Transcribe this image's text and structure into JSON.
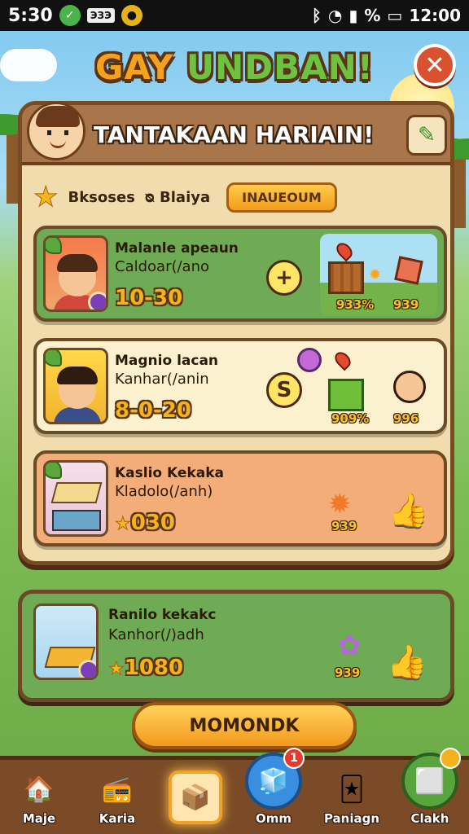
{
  "status": {
    "time_left": "5:30",
    "box_label": "ЭЗЭ",
    "right_time": "12:00",
    "percent": "%"
  },
  "title": {
    "part1": "GAY",
    "part2": "UNDBAN!"
  },
  "panel": {
    "title": "TANTAKAAN HARIAIN!"
  },
  "tabs": {
    "label1": "Bksoses",
    "label2": "ᴓ Blaiya",
    "active": "INAUEOUM"
  },
  "cards": [
    {
      "name": "Malanle apeaun",
      "sub": "Caldoar(/ano",
      "value": "10-30",
      "action": "+",
      "scene_lbl1": "933%",
      "scene_lbl2": "939"
    },
    {
      "name": "Magnio lacan",
      "sub": "Kanhar(/anin",
      "value": "8-0-20",
      "action": "S",
      "scene_lbl1": "909%",
      "scene_lbl2": "996"
    },
    {
      "name": "Kaslio Kekaka",
      "sub": "Kladolo(/anh)",
      "value": "030",
      "scene_lbl1": "939"
    }
  ],
  "bottom_card": {
    "name": "Ranilo kekakc",
    "sub": "Kanhor(/)adh",
    "value": "1080",
    "scene_lbl1": "939"
  },
  "main_button": {
    "label": "MOMONDK"
  },
  "nav": [
    {
      "label": "Maje",
      "icon": "house-icon"
    },
    {
      "label": "Karia",
      "icon": "radio-icon"
    },
    {
      "label": "",
      "icon": "crate-icon"
    },
    {
      "label": "Omm",
      "icon": "box-icon",
      "badge": "1"
    },
    {
      "label": "Paniagn",
      "icon": "card-icon"
    },
    {
      "label": "Clakh",
      "icon": "cube-icon",
      "badge": ""
    }
  ],
  "colors": {
    "accent": "#f29e1a",
    "panel": "#f1dcae",
    "wood": "#7a4a22",
    "green_card": "#6faa54"
  }
}
